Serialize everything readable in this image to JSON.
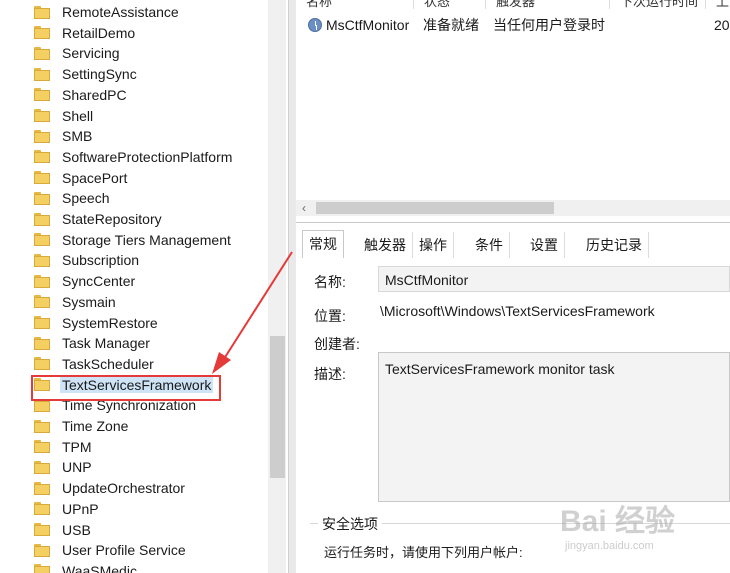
{
  "tree": {
    "items": [
      {
        "label": "RemoteAssistance"
      },
      {
        "label": "RetailDemo"
      },
      {
        "label": "Servicing"
      },
      {
        "label": "SettingSync"
      },
      {
        "label": "SharedPC"
      },
      {
        "label": "Shell"
      },
      {
        "label": "SMB"
      },
      {
        "label": "SoftwareProtectionPlatform"
      },
      {
        "label": "SpacePort"
      },
      {
        "label": "Speech"
      },
      {
        "label": "StateRepository"
      },
      {
        "label": "Storage Tiers Management"
      },
      {
        "label": "Subscription"
      },
      {
        "label": "SyncCenter"
      },
      {
        "label": "Sysmain"
      },
      {
        "label": "SystemRestore"
      },
      {
        "label": "Task Manager"
      },
      {
        "label": "TaskScheduler"
      },
      {
        "label": "TextServicesFramework",
        "selected": true
      },
      {
        "label": "Time Synchronization"
      },
      {
        "label": "Time Zone"
      },
      {
        "label": "TPM"
      },
      {
        "label": "UNP"
      },
      {
        "label": "UpdateOrchestrator"
      },
      {
        "label": "UPnP"
      },
      {
        "label": "USB"
      },
      {
        "label": "User Profile Service"
      },
      {
        "label": "WaaSMedic"
      }
    ]
  },
  "task_list": {
    "columns": [
      "名称",
      "状态",
      "触发器",
      "下次运行时间",
      "上"
    ],
    "rows": [
      {
        "name": "MsCtfMonitor",
        "status": "准备就绪",
        "trigger": "当任何用户登录时",
        "next_run": "20"
      }
    ]
  },
  "tabs": [
    "常规",
    "触发器",
    "操作",
    "条件",
    "设置",
    "历史记录"
  ],
  "active_tab": "常规",
  "general": {
    "name_label": "名称:",
    "name_value": "MsCtfMonitor",
    "location_label": "位置:",
    "location_value": "\\Microsoft\\Windows\\TextServicesFramework",
    "author_label": "创建者:",
    "description_label": "描述:",
    "description_value": "TextServicesFramework monitor task",
    "security_group": "安全选项",
    "run_as_label": "运行任务时，请使用下列用户帐户:"
  },
  "colors": {
    "annotation": "#e53a3a",
    "selection": "#cfe4f7",
    "folder": "#f4cf62"
  },
  "watermark": {
    "main": "Bai 经验",
    "sub": "jingyan.baidu.com"
  }
}
